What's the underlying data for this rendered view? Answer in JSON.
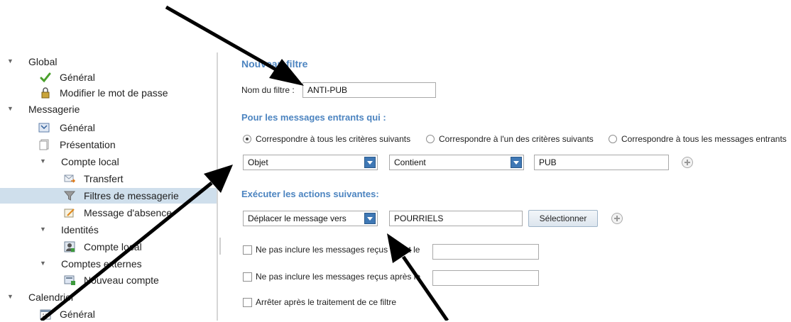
{
  "sidebar": {
    "items": [
      {
        "label": "Global",
        "level": 0,
        "expanded": true,
        "icon": "none"
      },
      {
        "label": "Général",
        "level": 1,
        "icon": "checkmark-icon"
      },
      {
        "label": "Modifier le mot de passe",
        "level": 1,
        "icon": "lock-icon"
      },
      {
        "label": "Messagerie",
        "level": 0,
        "expanded": true,
        "icon": "none"
      },
      {
        "label": "Général",
        "level": 1,
        "icon": "mail-settings-icon"
      },
      {
        "label": "Présentation",
        "level": 1,
        "icon": "pages-icon"
      },
      {
        "label": "Compte local",
        "level": 1,
        "expanded": true,
        "icon": "none"
      },
      {
        "label": "Transfert",
        "level": 2,
        "icon": "mail-forward-icon"
      },
      {
        "label": "Filtres de messagerie",
        "level": 2,
        "icon": "funnel-icon",
        "selected": true
      },
      {
        "label": "Message d'absence",
        "level": 2,
        "icon": "note-pencil-icon"
      },
      {
        "label": "Identités",
        "level": 1,
        "expanded": true,
        "icon": "none"
      },
      {
        "label": "Compte local",
        "level": 2,
        "icon": "user-card-icon"
      },
      {
        "label": "Comptes externes",
        "level": 1,
        "expanded": true,
        "icon": "none"
      },
      {
        "label": "Nouveau compte",
        "level": 2,
        "icon": "add-account-icon"
      },
      {
        "label": "Calendrier",
        "level": 0,
        "expanded": true,
        "icon": "none"
      },
      {
        "label": "Général",
        "level": 1,
        "icon": "calendar-icon"
      }
    ]
  },
  "form": {
    "title": "Nouveau filtre",
    "filter_name_label": "Nom du filtre :",
    "filter_name_value": "ANTI-PUB",
    "incoming_heading": "Pour les messages entrants qui :",
    "match_options": [
      {
        "label": "Correspondre à tous les critères suivants",
        "checked": true
      },
      {
        "label": "Correspondre à l'un des critères suivants",
        "checked": false
      },
      {
        "label": "Correspondre à tous les messages entrants",
        "checked": false
      }
    ],
    "rule": {
      "field": "Objet",
      "operator": "Contient",
      "value": "PUB"
    },
    "actions_heading": "Exécuter les actions suivantes:",
    "action": {
      "type": "Déplacer le message vers",
      "folder": "POURRIELS",
      "select_label": "Sélectionner"
    },
    "exclude_before_label": "Ne pas inclure les messages reçus avant le",
    "exclude_after_label": "Ne pas inclure les messages reçus après le",
    "stop_label": "Arrêter après le traitement de ce filtre"
  },
  "colors": {
    "heading": "#4c84c0",
    "selection": "#cfdfec",
    "combo_button": "#3f78b5",
    "arrow": "#000000"
  }
}
